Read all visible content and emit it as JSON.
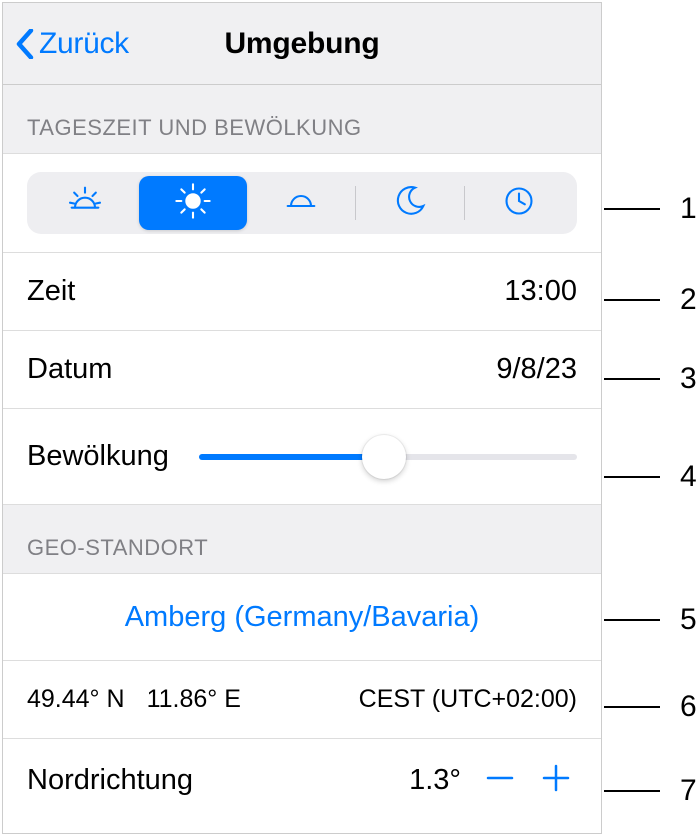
{
  "nav": {
    "back_label": "Zurück",
    "title": "Umgebung"
  },
  "section1": {
    "header": "TAGESZEIT UND BEWÖLKUNG",
    "segments": [
      "sunrise",
      "day",
      "sunset",
      "night",
      "time"
    ],
    "selected_segment": 1,
    "time_label": "Zeit",
    "time_value": "13:00",
    "date_label": "Datum",
    "date_value": "9/8/23",
    "clouds_label": "Bewölkung",
    "clouds_value_pct": 49
  },
  "section2": {
    "header": "GEO-STANDORT",
    "location": "Amberg (Germany/Bavaria)",
    "latitude": "49.44° N",
    "longitude": "11.86° E",
    "timezone": "CEST (UTC+02:00)",
    "north_label": "Nordrichtung",
    "north_value": "1.3°"
  },
  "callouts": [
    "1",
    "2",
    "3",
    "4",
    "5",
    "6",
    "7"
  ]
}
